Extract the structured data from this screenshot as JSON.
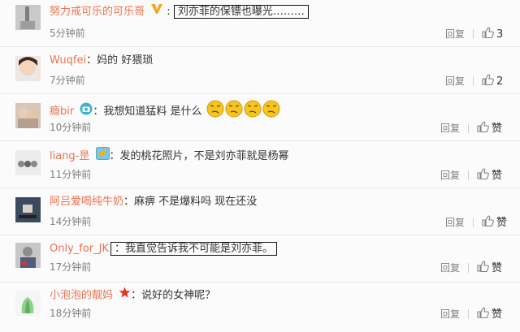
{
  "comments": [
    {
      "user": "努力戒可乐的可乐哥",
      "text": "刘亦菲的保镖也曝光………",
      "time": "5分钟前",
      "reply": "回复",
      "like": "3"
    },
    {
      "user": "Wuqfei",
      "text": "妈的 好猥琐",
      "time": "7分钟前",
      "reply": "回复",
      "like": "2"
    },
    {
      "user": "瘾bir",
      "text": "我想知道猛料 是什么",
      "time": "10分钟前",
      "reply": "回复",
      "like": "赞"
    },
    {
      "user": "liang-昰",
      "text": "发的桃花照片，不是刘亦菲就是杨幂",
      "time": "11分钟前",
      "reply": "回复",
      "like": "赞"
    },
    {
      "user": "阿吕爱喝纯牛奶",
      "text": "麻痹 不是爆料吗 现在还没",
      "time": "14分钟前",
      "reply": "回复",
      "like": "赞"
    },
    {
      "user": "Only_for_JK",
      "text": "我直觉告诉我不可能是刘亦菲。",
      "time": "17分钟前",
      "reply": "回复",
      "like": "赞"
    },
    {
      "user": "小泡泡的靓妈",
      "text": "说好的女神呢？",
      "time": "18分钟前",
      "reply": "回复",
      "like": "赞"
    }
  ],
  "icons": {
    "verified": "v-verified-icon",
    "camera": "camera-icon",
    "bird": "bird-icon",
    "star": "star-icon",
    "like": "thumbs-up-icon",
    "emoji": "smirk-face-icon"
  },
  "colors": {
    "username": "#eb7350",
    "username_blue": "#4e8dc8",
    "time": "#808080"
  }
}
